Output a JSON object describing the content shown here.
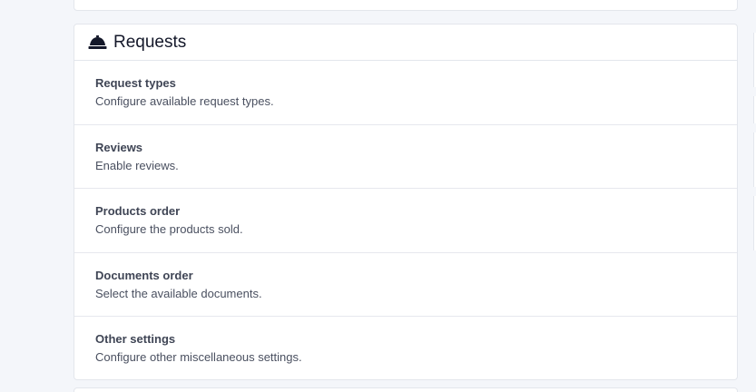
{
  "requests_card": {
    "title": "Requests",
    "icon": "concierge-bell-icon",
    "items": [
      {
        "title": "Request types",
        "description": "Configure available request types."
      },
      {
        "title": "Reviews",
        "description": "Enable reviews."
      },
      {
        "title": "Products order",
        "description": "Configure the products sold."
      },
      {
        "title": "Documents order",
        "description": "Select the available documents."
      },
      {
        "title": "Other settings",
        "description": "Configure other miscellaneous settings."
      }
    ]
  },
  "colors": {
    "page_background": "#f4f6fa",
    "card_background": "#ffffff",
    "border": "#e3e6ec",
    "title_text": "#14182a",
    "item_text": "#3f4555"
  }
}
